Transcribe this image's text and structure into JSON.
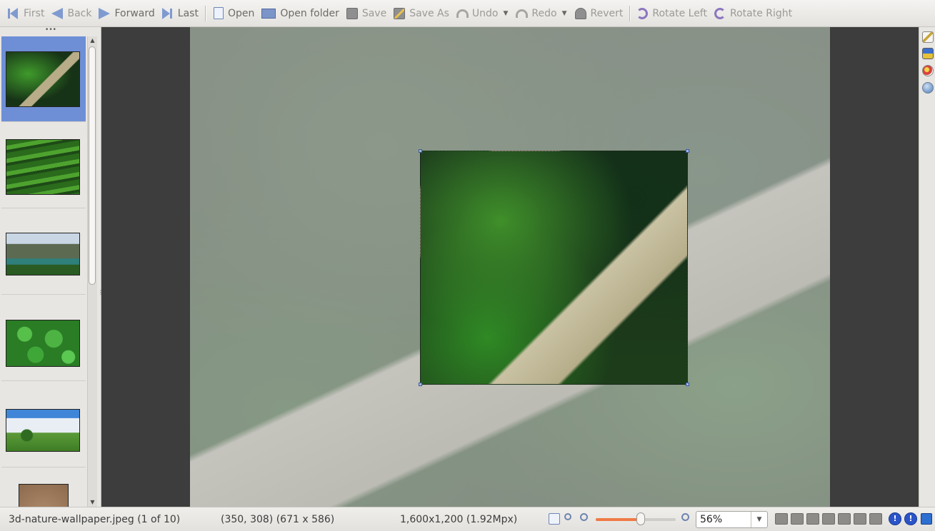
{
  "toolbar": {
    "first": "First",
    "back": "Back",
    "forward": "Forward",
    "last": "Last",
    "open": "Open",
    "open_folder": "Open folder",
    "save": "Save",
    "save_as": "Save As",
    "undo": "Undo",
    "redo": "Redo",
    "revert": "Revert",
    "rotate_left": "Rotate Left",
    "rotate_right": "Rotate Right"
  },
  "thumbnails": [
    {
      "subject": "forest-boardwalk",
      "selected": true
    },
    {
      "subject": "rice-terraces",
      "selected": false
    },
    {
      "subject": "rock-arch-coast",
      "selected": false
    },
    {
      "subject": "green-leaves",
      "selected": false
    },
    {
      "subject": "tree-on-meadow",
      "selected": false
    },
    {
      "subject": "stone-texture",
      "selected": false
    }
  ],
  "status": {
    "filename": "3d-nature-wallpaper.jpeg (1 of 10)",
    "selection": "(350, 308) (671 x 586)",
    "dimensions": "1,600x1,200 (1.92Mpx)",
    "zoom_value": "56%",
    "zoom_fraction": 0.56
  },
  "colors": {
    "selection_highlight": "#6e8fd6",
    "slider_accent": "#ef7a45",
    "info_blue": "#2b55c8"
  },
  "icons": {
    "first": "arrow-left-bar-icon",
    "back": "arrow-left-icon",
    "forward": "arrow-right-icon",
    "last": "arrow-right-bar-icon",
    "open": "document-icon",
    "open_folder": "folder-icon",
    "save": "floppy-icon",
    "save_as": "pencil-floppy-icon",
    "undo": "undo-icon",
    "redo": "redo-icon",
    "revert": "revert-icon",
    "rotate_left": "rotate-left-icon",
    "rotate_right": "rotate-right-icon"
  }
}
